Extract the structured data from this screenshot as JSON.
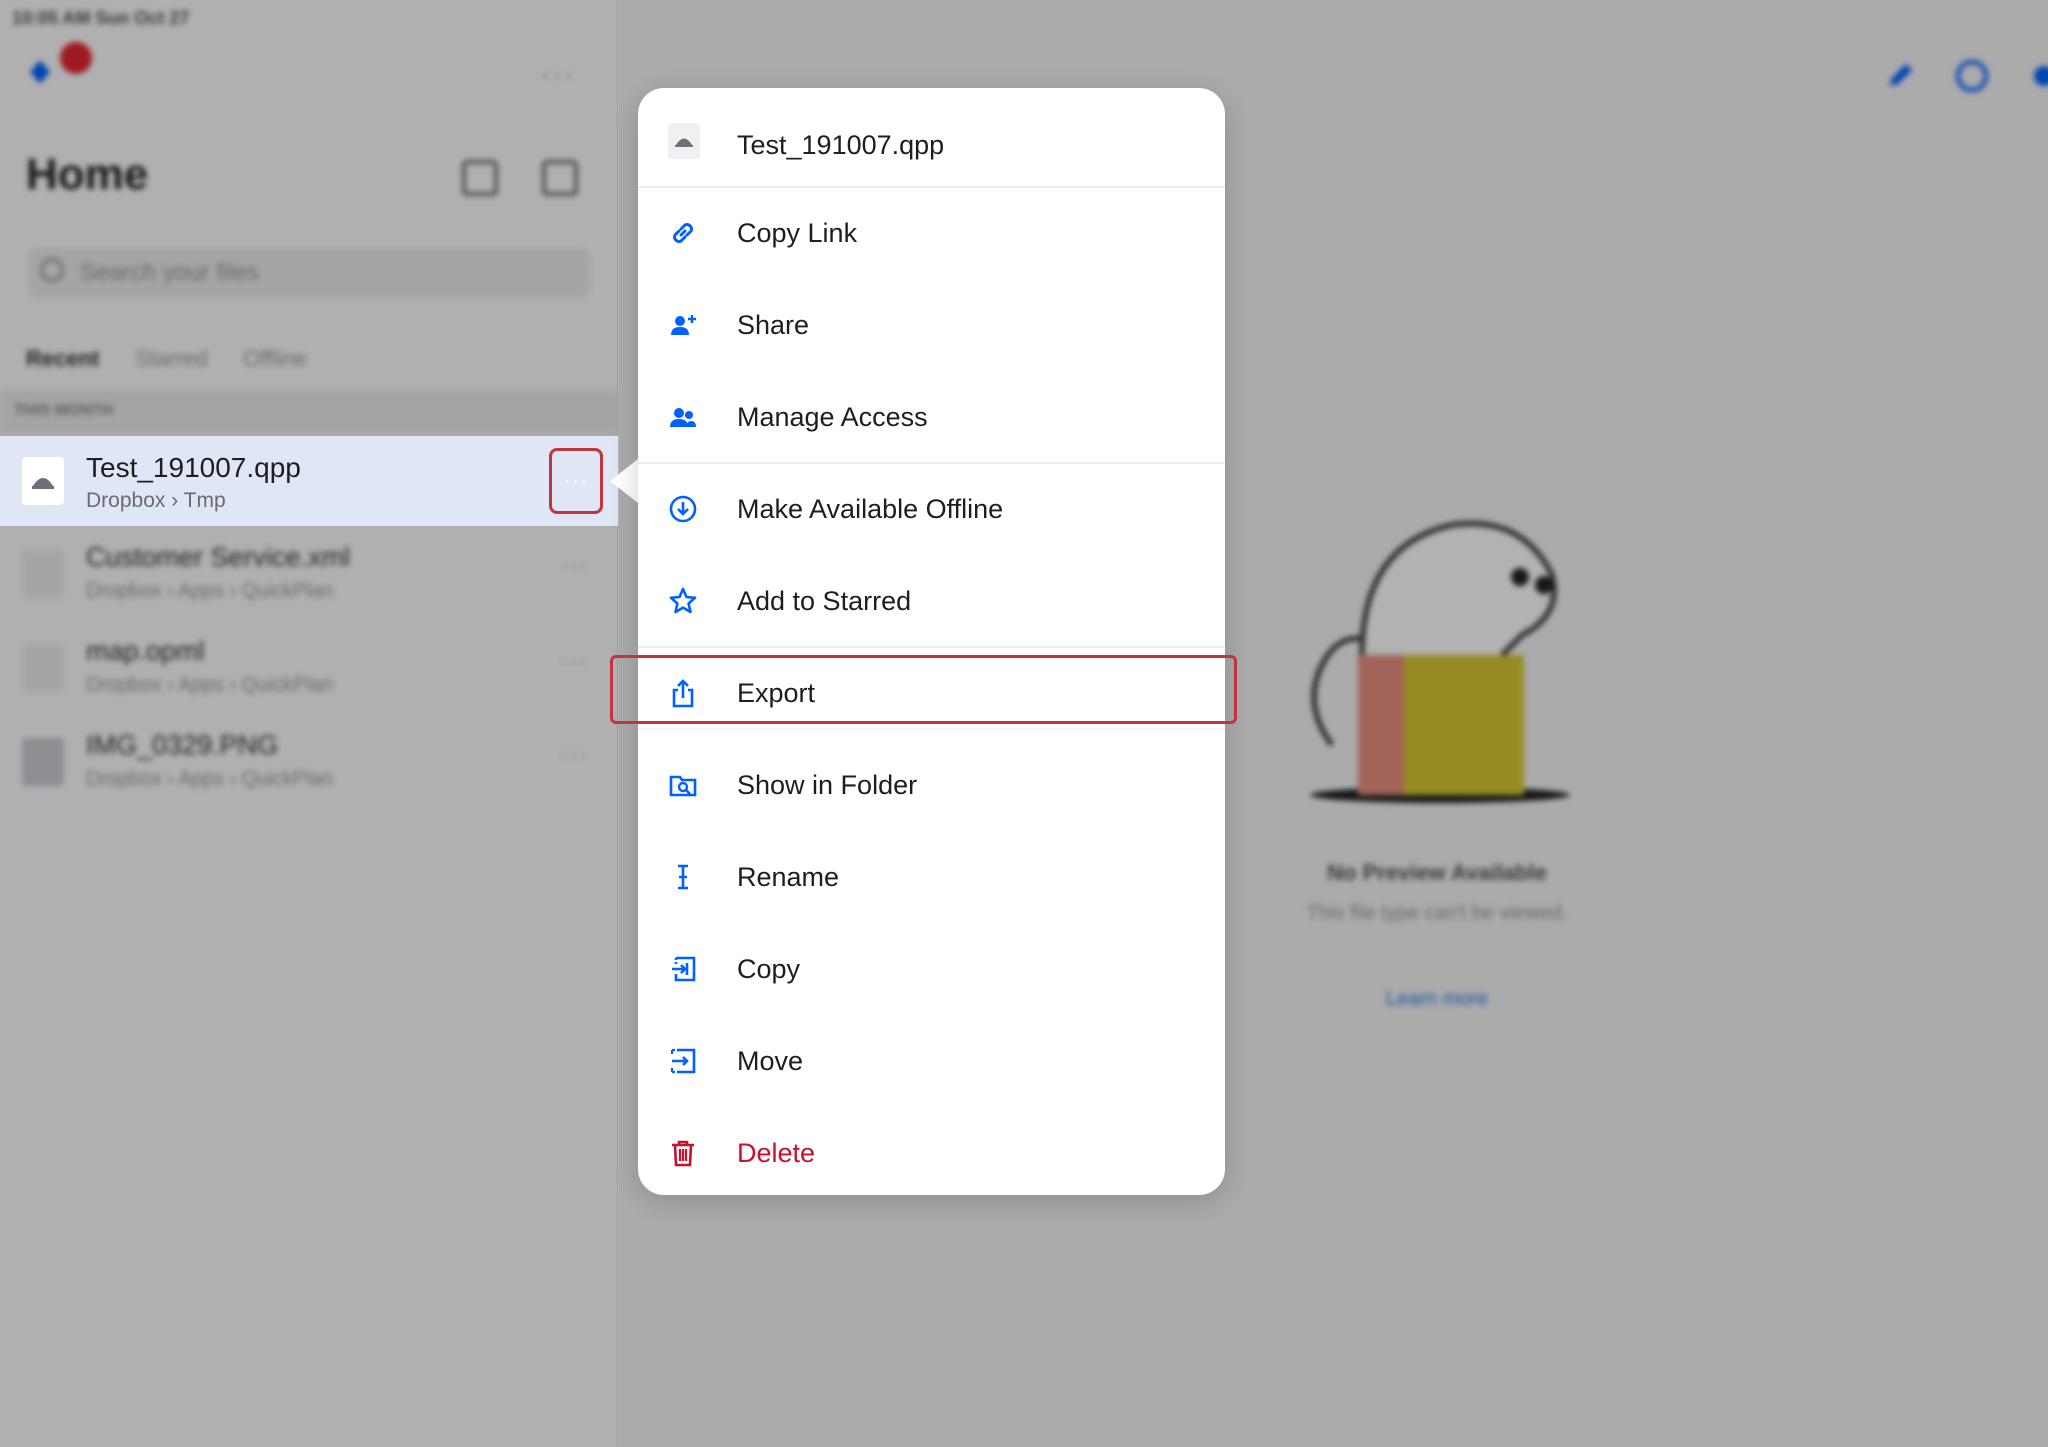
{
  "status_bar": {
    "time_date": "10:05 AM  Sun Oct 27"
  },
  "sidebar": {
    "title": "Home",
    "search_placeholder": "Search your files",
    "tabs": [
      "Recent",
      "Starred",
      "Offline"
    ],
    "section_header": "THIS MONTH",
    "files": [
      {
        "name": "Test_191007.qpp",
        "path": "Dropbox › Tmp",
        "more": "···"
      },
      {
        "name": "Customer Service.xml",
        "path": "Dropbox › Apps › QuickPlan",
        "more": "···"
      },
      {
        "name": "map.opml",
        "path": "Dropbox › Apps › QuickPlan",
        "more": "···"
      },
      {
        "name": "IMG_0329.PNG",
        "path": "Dropbox › Apps › QuickPlan",
        "more": "···"
      }
    ]
  },
  "preview": {
    "title": "No Preview Available",
    "subtitle": "This file type can't be viewed.",
    "link": "Learn more"
  },
  "menu": {
    "file_name": "Test_191007.qpp",
    "items": [
      {
        "label": "Copy Link",
        "icon": "link-icon"
      },
      {
        "label": "Share",
        "icon": "share-person-icon"
      },
      {
        "label": "Manage Access",
        "icon": "people-icon"
      },
      {
        "label": "Make Available Offline",
        "icon": "offline-download-icon"
      },
      {
        "label": "Add to Starred",
        "icon": "star-icon"
      },
      {
        "label": "Export",
        "icon": "export-icon"
      },
      {
        "label": "Show in Folder",
        "icon": "folder-search-icon"
      },
      {
        "label": "Rename",
        "icon": "text-cursor-icon"
      },
      {
        "label": "Copy",
        "icon": "copy-icon"
      },
      {
        "label": "Move",
        "icon": "move-icon"
      },
      {
        "label": "Delete",
        "icon": "trash-icon"
      }
    ]
  },
  "colors": {
    "accent": "#0061fe",
    "danger": "#c8102e",
    "highlight": "#c0363c",
    "selected_row": "#dfe6f6"
  }
}
